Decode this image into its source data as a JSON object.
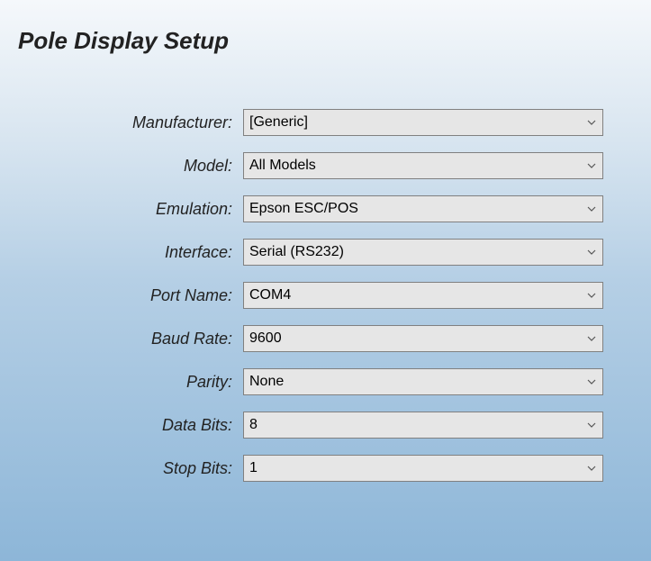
{
  "title": "Pole Display Setup",
  "fields": {
    "manufacturer": {
      "label": "Manufacturer:",
      "value": "[Generic]"
    },
    "model": {
      "label": "Model:",
      "value": "All Models"
    },
    "emulation": {
      "label": "Emulation:",
      "value": "Epson ESC/POS"
    },
    "interface": {
      "label": "Interface:",
      "value": "Serial (RS232)"
    },
    "port_name": {
      "label": "Port Name:",
      "value": "COM4"
    },
    "baud_rate": {
      "label": "Baud Rate:",
      "value": "9600"
    },
    "parity": {
      "label": "Parity:",
      "value": "None"
    },
    "data_bits": {
      "label": "Data Bits:",
      "value": "8"
    },
    "stop_bits": {
      "label": "Stop Bits:",
      "value": "1"
    }
  }
}
